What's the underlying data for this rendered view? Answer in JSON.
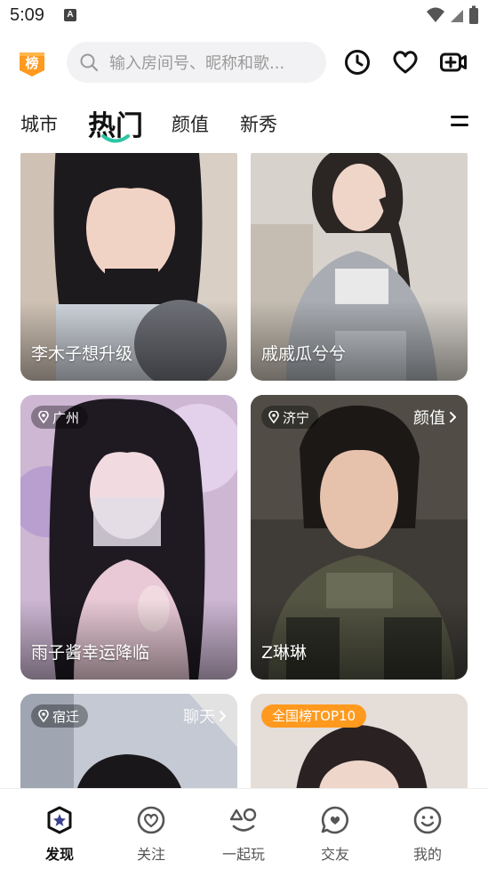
{
  "status_bar": {
    "time": "5:09",
    "notif_letter": "A"
  },
  "header": {
    "rank_badge": "榜",
    "search_placeholder": "输入房间号、昵称和歌...",
    "icons": [
      "history-clock-icon",
      "heart-icon",
      "video-camera-plus-icon"
    ]
  },
  "tabs": [
    {
      "label": "城市",
      "active": false
    },
    {
      "label": "热门",
      "active": true
    },
    {
      "label": "颜值",
      "active": false
    },
    {
      "label": "新秀",
      "active": false
    }
  ],
  "cards": [
    {
      "name": "李木子想升级",
      "location": "",
      "tag": "",
      "badge": ""
    },
    {
      "name": "戚戚瓜兮兮",
      "location": "",
      "tag": "",
      "badge": ""
    },
    {
      "name": "雨子酱幸运降临",
      "location": "广州",
      "tag": "",
      "badge": ""
    },
    {
      "name": "Z琳琳",
      "location": "济宁",
      "tag": "颜值",
      "badge": ""
    },
    {
      "name": "",
      "location": "宿迁",
      "tag": "聊天",
      "badge": ""
    },
    {
      "name": "",
      "location": "",
      "tag": "",
      "badge": "全国榜TOP10"
    }
  ],
  "bottom_nav": [
    {
      "label": "发现",
      "icon": "discover-star-icon",
      "active": true
    },
    {
      "label": "关注",
      "icon": "follow-heart-icon",
      "active": false
    },
    {
      "label": "一起玩",
      "icon": "play-together-icon",
      "active": false
    },
    {
      "label": "交友",
      "icon": "chat-bubble-icon",
      "active": false
    },
    {
      "label": "我的",
      "icon": "smile-face-icon",
      "active": false
    }
  ],
  "colors": {
    "accent": "#2ec4a6",
    "badge_orange": "#ff9a1f"
  }
}
